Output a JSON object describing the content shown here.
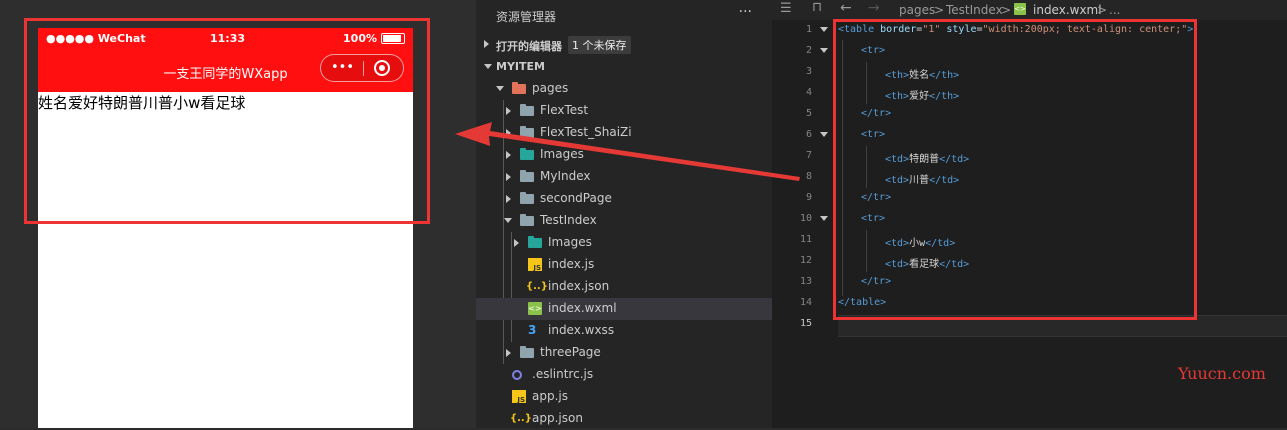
{
  "phone": {
    "carrier": "●●●●● WeChat",
    "time": "11:33",
    "battery": "100%",
    "nav_title": "一支王同学的WXapp",
    "capsule_dots": "•••",
    "content_cells": [
      "姓名",
      "爱好",
      "特朗普",
      "川普",
      "小w",
      "看足球"
    ]
  },
  "explorer": {
    "title": "资源管理器",
    "more": "···",
    "open_editors": "打开的编辑器",
    "unsaved_badge": "1 个未保存",
    "project": "MYITEM",
    "tree": [
      {
        "label": "pages",
        "icon": "folder-pages-icon"
      },
      {
        "label": "FlexTest",
        "icon": "folder-icon"
      },
      {
        "label": "FlexTest_ShaiZi",
        "icon": "folder-icon"
      },
      {
        "label": "Images",
        "icon": "folder-images-icon"
      },
      {
        "label": "MyIndex",
        "icon": "folder-icon"
      },
      {
        "label": "secondPage",
        "icon": "folder-icon"
      },
      {
        "label": "TestIndex",
        "icon": "folder-open-icon"
      },
      {
        "label": "Images",
        "icon": "folder-images-icon"
      },
      {
        "label": "index.js",
        "icon": "js-icon"
      },
      {
        "label": "index.json",
        "icon": "json-icon"
      },
      {
        "label": "index.wxml",
        "icon": "wxml-icon"
      },
      {
        "label": "index.wxss",
        "icon": "wxss-icon"
      },
      {
        "label": "threePage",
        "icon": "folder-icon"
      },
      {
        "label": ".eslintrc.js",
        "icon": "eslint-icon"
      },
      {
        "label": "app.js",
        "icon": "js-icon"
      },
      {
        "label": "app.json",
        "icon": "json-icon"
      }
    ]
  },
  "editor": {
    "breadcrumb": [
      "pages",
      ">",
      "TestIndex",
      ">",
      "index.wxml",
      ">",
      "..."
    ],
    "line_numbers": [
      "1",
      "2",
      "3",
      "4",
      "5",
      "6",
      "7",
      "8",
      "9",
      "10",
      "11",
      "12",
      "13",
      "14",
      "15"
    ],
    "code": {
      "l1_open": "<table",
      "l1_a1": " border",
      "l1_eq1": "=",
      "l1_v1": "\"1\"",
      "l1_a2": " style",
      "l1_eq2": "=",
      "l1_v2": "\"width:200px; text-align: center;\"",
      "l1_close": ">",
      "tr_open": "<tr>",
      "tr_close": "</tr>",
      "th_open": "<th>",
      "th_close": "</th>",
      "td_open": "<td>",
      "td_close": "</td>",
      "th1": "姓名",
      "th2": "爱好",
      "td1": "特朗普",
      "td2": "川普",
      "td3": "小w",
      "td4": "看足球",
      "table_close": "</table>"
    }
  },
  "watermark": "Yuucn.com",
  "colors": {
    "nav_red": "#ff0f0f",
    "annotation_red": "#e33333"
  }
}
